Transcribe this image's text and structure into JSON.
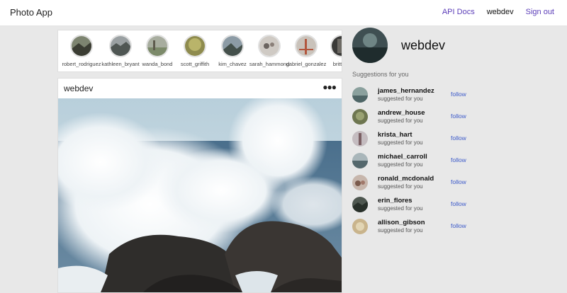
{
  "app": {
    "title": "Photo App"
  },
  "nav": {
    "api_docs": "API Docs",
    "username": "webdev",
    "sign_out": "Sign out"
  },
  "stories": [
    {
      "username": "robert_rodriguez"
    },
    {
      "username": "kathleen_bryant"
    },
    {
      "username": "wanda_bond"
    },
    {
      "username": "scott_griffith"
    },
    {
      "username": "kim_chavez"
    },
    {
      "username": "sarah_hammond"
    },
    {
      "username": "gabriel_gonzalez"
    },
    {
      "username": "brittany"
    }
  ],
  "post": {
    "username": "webdev",
    "more_icon": "more-horizontal-icon"
  },
  "profile": {
    "username": "webdev"
  },
  "suggestions": {
    "title": "Suggestions for you",
    "items": [
      {
        "username": "james_hernandez",
        "subtitle": "suggested for you",
        "action": "follow"
      },
      {
        "username": "andrew_house",
        "subtitle": "suggested for you",
        "action": "follow"
      },
      {
        "username": "krista_hart",
        "subtitle": "suggested for you",
        "action": "follow"
      },
      {
        "username": "michael_carroll",
        "subtitle": "suggested for you",
        "action": "follow"
      },
      {
        "username": "ronald_mcdonald",
        "subtitle": "suggested for you",
        "action": "follow"
      },
      {
        "username": "erin_flores",
        "subtitle": "suggested for you",
        "action": "follow"
      },
      {
        "username": "allison_gibson",
        "subtitle": "suggested for you",
        "action": "follow"
      }
    ]
  },
  "colors": {
    "link": "#5b3db8",
    "follow": "#3a58c9",
    "background": "#e8e8e8"
  }
}
